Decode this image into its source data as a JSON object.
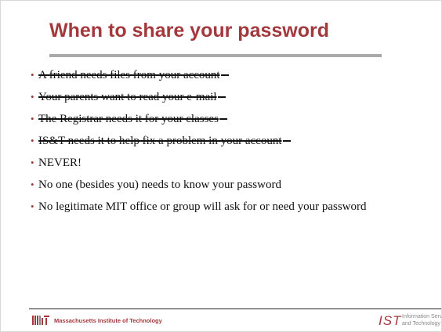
{
  "slide": {
    "title": "When to share your password",
    "bullets": [
      {
        "text": "A friend needs files from your account",
        "struck": true
      },
      {
        "text": "Your parents want to read your e-mail",
        "struck": true
      },
      {
        "text": "The Registrar needs it for your classes",
        "struck": true
      },
      {
        "text": "IS&T needs it to help fix a problem in your account",
        "struck": true
      },
      {
        "text": "NEVER!",
        "struck": false
      },
      {
        "text": "No one (besides you) needs to know your password",
        "struck": false
      },
      {
        "text": "No legitimate MIT office or group will ask for or need your password",
        "struck": false
      }
    ],
    "bullet_glyph": "•"
  },
  "footer": {
    "org_name": "Massachusetts Institute of Technology",
    "dept_mark": "IST",
    "dept_line1": "Information Services",
    "dept_line2": "and Technology"
  },
  "colors": {
    "accent": "#a3383d",
    "rule_gray": "#a9a9a9",
    "text": "#111111"
  },
  "icons": {
    "mit_logo": "mit-logo-icon",
    "ist_logo": "ist-logo-icon"
  }
}
